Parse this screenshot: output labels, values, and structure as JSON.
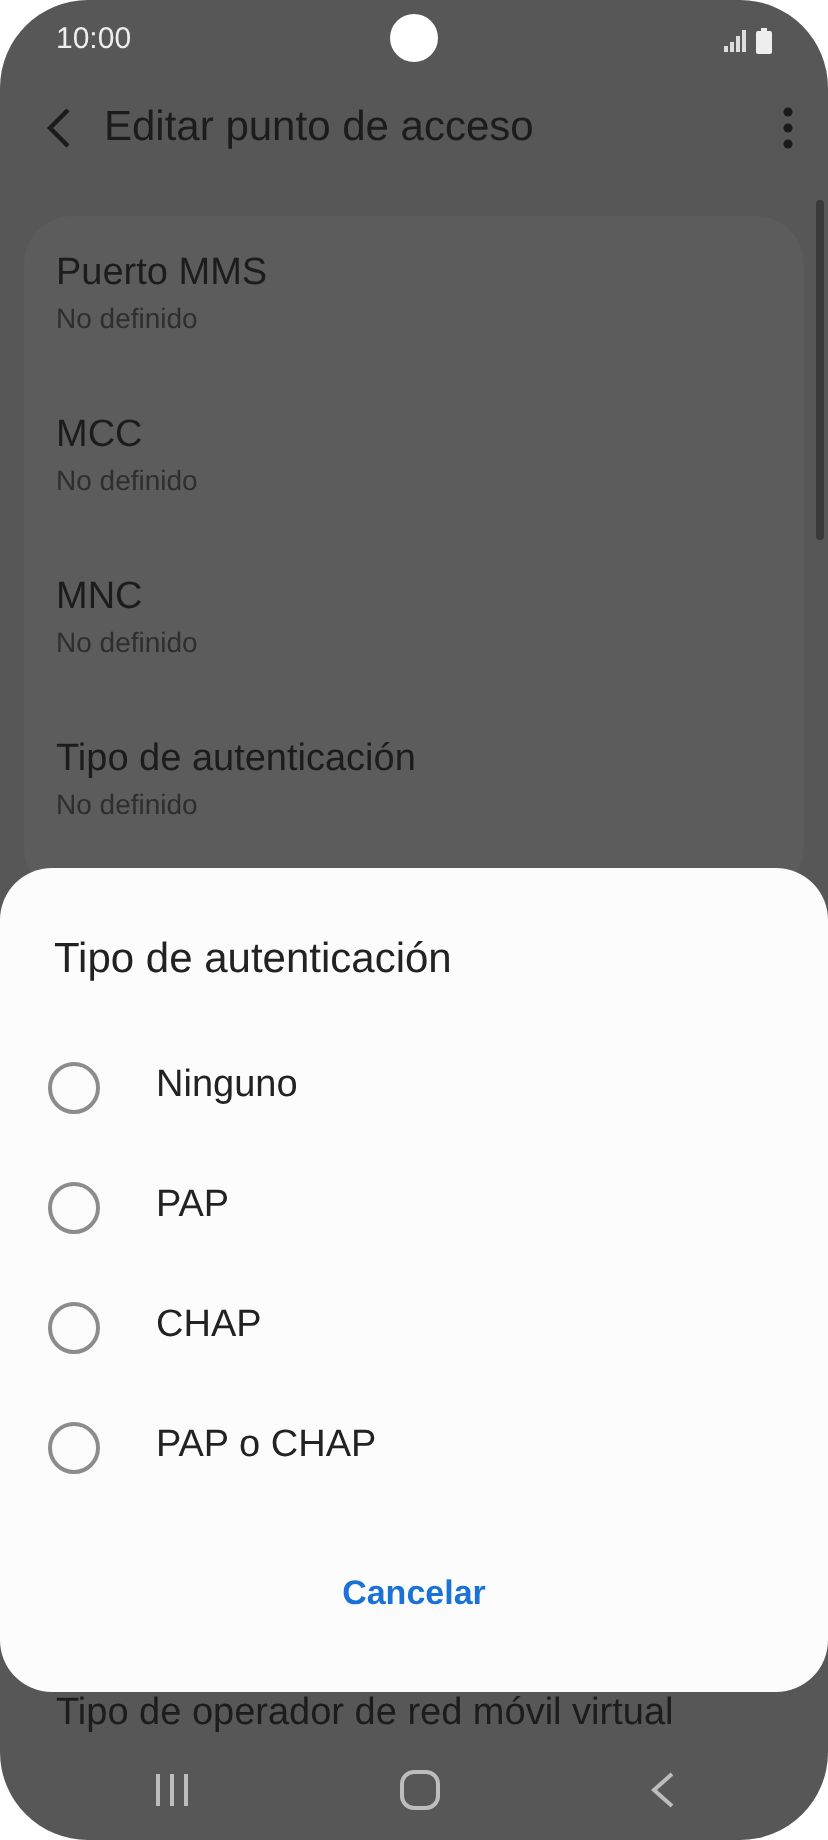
{
  "status_bar": {
    "time": "10:00"
  },
  "header": {
    "title": "Editar punto de acceso"
  },
  "settings": [
    {
      "title": "Puerto MMS",
      "value": "No definido"
    },
    {
      "title": "MCC",
      "value": "No definido"
    },
    {
      "title": "MNC",
      "value": "No definido"
    },
    {
      "title": "Tipo de autenticación",
      "value": "No definido"
    }
  ],
  "dialog": {
    "title": "Tipo de autenticación",
    "options": [
      {
        "label": "Ninguno",
        "selected": false
      },
      {
        "label": "PAP",
        "selected": false
      },
      {
        "label": "CHAP",
        "selected": false
      },
      {
        "label": "PAP o CHAP",
        "selected": false
      }
    ],
    "cancel": "Cancelar"
  },
  "behind_dialog": {
    "partial_item": "Tipo de operador de red móvil virtual"
  }
}
